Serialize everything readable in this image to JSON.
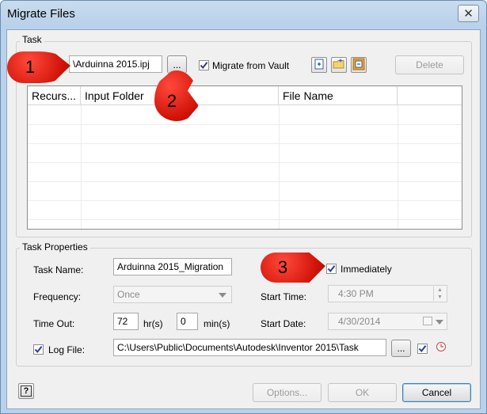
{
  "window": {
    "title": "Migrate Files"
  },
  "task": {
    "group_label": "Task",
    "file_path_value": "\\Arduinna 2015.ipj",
    "browse_label": "...",
    "migrate_from_vault_label": "Migrate from Vault",
    "migrate_from_vault_checked": true,
    "delete_label": "Delete",
    "columns": [
      "Recurs...",
      "Input Folder",
      "File Name",
      ""
    ]
  },
  "props": {
    "group_label": "Task Properties",
    "task_name_label": "Task Name:",
    "task_name_value": "Arduinna 2015_Migration",
    "immediately_label": "Immediately",
    "frequency_label": "Frequency:",
    "frequency_value": "Once",
    "start_time_label": "Start Time:",
    "start_time_value": "4:30 PM",
    "timeout_label": "Time Out:",
    "timeout_hours": "72",
    "hours_unit": "hr(s)",
    "timeout_minutes": "0",
    "minutes_unit": "min(s)",
    "start_date_label": "Start Date:",
    "start_date_value": "4/30/2014",
    "log_file_label": "Log File:",
    "log_file_value": "C:\\Users\\Public\\Documents\\Autodesk\\Inventor 2015\\Task",
    "log_browse_label": "..."
  },
  "footer": {
    "help_label": "?",
    "options_label": "Options...",
    "ok_label": "OK",
    "cancel_label": "Cancel"
  },
  "callouts": [
    "1",
    "2",
    "3"
  ],
  "colors": {
    "callout": "#d21309",
    "titlebar": "#b9d1ea",
    "client": "#f0f0f0"
  }
}
